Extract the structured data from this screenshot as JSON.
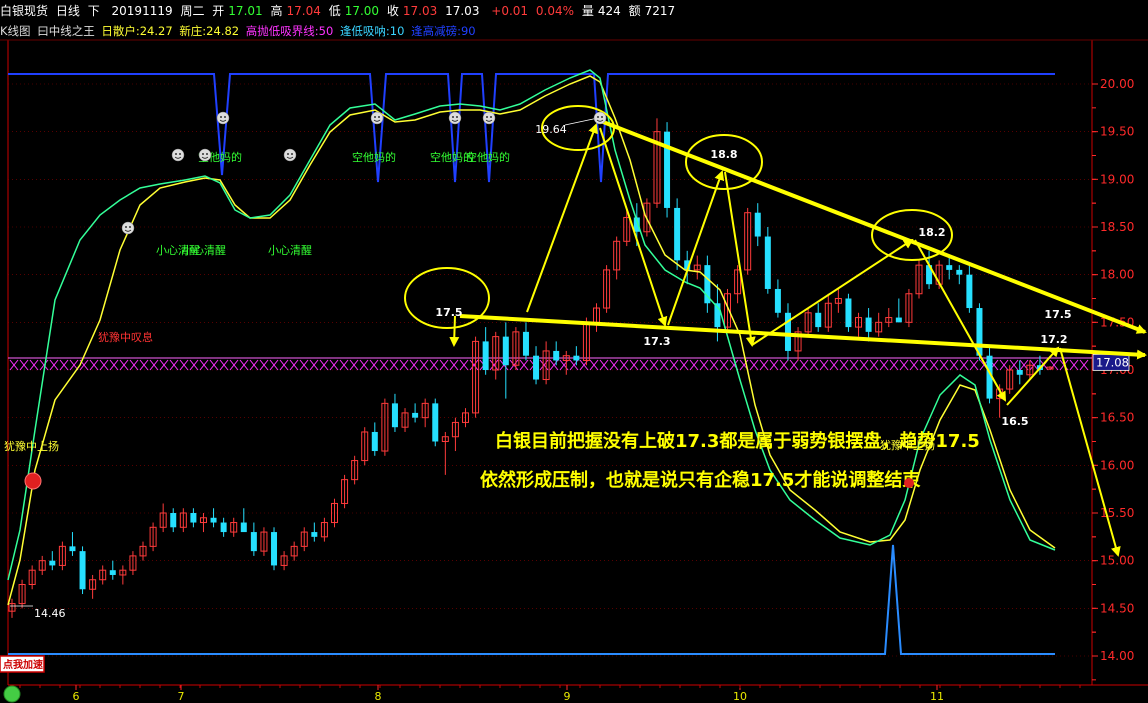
{
  "header": {
    "title": "白银现货",
    "period": "日线",
    "dir": "下",
    "date": "20191119",
    "weekday": "周二",
    "open_label": "开",
    "open": "17.01",
    "high_label": "高",
    "high": "17.04",
    "low_label": "低",
    "low": "17.00",
    "close_label": "收",
    "close": "17.03",
    "last": "17.03",
    "change": "+0.01",
    "pct": "0.04%",
    "vol_label": "量",
    "vol": "424",
    "amt_label": "额",
    "amt": "7217"
  },
  "indicator": {
    "chart_label": "K线图",
    "name": "曰中线之王",
    "sanhu": "日散户:24.27",
    "xinzhuang": "新庄:24.82",
    "line1": "高抛低吸界线:50",
    "line2": "逢低吸呐:10",
    "line3": "逢高减磅:90"
  },
  "colors": {
    "up": "#ff3b3b",
    "down": "#26e0ff",
    "ma_yellow": "#ffff33",
    "ma_green": "#33ff99",
    "indicator_blue": "#2040ff",
    "annotation": "#ffff00",
    "grid_red": "#8b0000",
    "axis_red": "#ff2a2a"
  },
  "price_axis": {
    "ticks": [
      "20.00",
      "19.50",
      "19.00",
      "18.50",
      "18.00",
      "17.50",
      "17.00",
      "16.50",
      "16.00",
      "15.50",
      "15.00",
      "14.50",
      "14.00"
    ],
    "current_price": "17.08"
  },
  "time_axis": {
    "ticks": [
      "6",
      "7",
      "8",
      "9",
      "10",
      "11"
    ]
  },
  "chart_data": {
    "type": "candlestick",
    "ylim": [
      13.8,
      20.3
    ],
    "candles": [
      [
        14.47,
        14.6,
        14.4,
        14.55
      ],
      [
        14.55,
        14.8,
        14.5,
        14.75
      ],
      [
        14.75,
        14.95,
        14.7,
        14.9
      ],
      [
        14.9,
        15.05,
        14.85,
        15.0
      ],
      [
        15.0,
        15.1,
        14.9,
        14.95
      ],
      [
        14.95,
        15.2,
        14.9,
        15.15
      ],
      [
        15.15,
        15.3,
        15.05,
        15.1
      ],
      [
        15.1,
        15.15,
        14.65,
        14.7
      ],
      [
        14.7,
        14.85,
        14.6,
        14.8
      ],
      [
        14.8,
        14.95,
        14.75,
        14.9
      ],
      [
        14.9,
        15.0,
        14.8,
        14.85
      ],
      [
        14.85,
        14.95,
        14.75,
        14.9
      ],
      [
        14.9,
        15.1,
        14.85,
        15.05
      ],
      [
        15.05,
        15.2,
        15.0,
        15.15
      ],
      [
        15.15,
        15.4,
        15.1,
        15.35
      ],
      [
        15.35,
        15.6,
        15.3,
        15.5
      ],
      [
        15.5,
        15.55,
        15.3,
        15.35
      ],
      [
        15.35,
        15.55,
        15.3,
        15.5
      ],
      [
        15.5,
        15.55,
        15.35,
        15.4
      ],
      [
        15.4,
        15.5,
        15.3,
        15.45
      ],
      [
        15.45,
        15.55,
        15.35,
        15.4
      ],
      [
        15.4,
        15.45,
        15.25,
        15.3
      ],
      [
        15.3,
        15.45,
        15.25,
        15.4
      ],
      [
        15.4,
        15.55,
        15.35,
        15.3
      ],
      [
        15.3,
        15.4,
        15.05,
        15.1
      ],
      [
        15.1,
        15.35,
        15.05,
        15.3
      ],
      [
        15.3,
        15.35,
        14.9,
        14.95
      ],
      [
        14.95,
        15.1,
        14.9,
        15.05
      ],
      [
        15.05,
        15.2,
        15.0,
        15.15
      ],
      [
        15.15,
        15.35,
        15.1,
        15.3
      ],
      [
        15.3,
        15.4,
        15.2,
        15.25
      ],
      [
        15.25,
        15.45,
        15.2,
        15.4
      ],
      [
        15.4,
        15.65,
        15.35,
        15.6
      ],
      [
        15.6,
        15.9,
        15.55,
        15.85
      ],
      [
        15.85,
        16.1,
        15.8,
        16.05
      ],
      [
        16.05,
        16.4,
        16.0,
        16.35
      ],
      [
        16.35,
        16.45,
        16.1,
        16.15
      ],
      [
        16.15,
        16.7,
        16.1,
        16.65
      ],
      [
        16.65,
        16.75,
        16.35,
        16.4
      ],
      [
        16.4,
        16.6,
        16.35,
        16.55
      ],
      [
        16.55,
        16.65,
        16.45,
        16.5
      ],
      [
        16.5,
        16.7,
        16.4,
        16.65
      ],
      [
        16.65,
        16.7,
        16.2,
        16.25
      ],
      [
        16.25,
        16.35,
        15.9,
        16.3
      ],
      [
        16.3,
        16.5,
        16.15,
        16.45
      ],
      [
        16.45,
        16.6,
        16.4,
        16.55
      ],
      [
        16.55,
        17.35,
        16.5,
        17.3
      ],
      [
        17.3,
        17.45,
        16.95,
        17.0
      ],
      [
        17.0,
        17.4,
        16.9,
        17.35
      ],
      [
        17.35,
        17.5,
        16.7,
        17.05
      ],
      [
        17.05,
        17.45,
        17.0,
        17.4
      ],
      [
        17.4,
        17.5,
        17.1,
        17.15
      ],
      [
        17.15,
        17.25,
        16.85,
        16.9
      ],
      [
        16.9,
        17.3,
        16.85,
        17.2
      ],
      [
        17.2,
        17.3,
        17.05,
        17.1
      ],
      [
        17.1,
        17.2,
        16.95,
        17.15
      ],
      [
        17.15,
        17.25,
        17.05,
        17.1
      ],
      [
        17.1,
        17.55,
        17.05,
        17.5
      ],
      [
        17.5,
        17.7,
        17.4,
        17.65
      ],
      [
        17.65,
        18.1,
        17.6,
        18.05
      ],
      [
        18.05,
        18.4,
        17.95,
        18.35
      ],
      [
        18.35,
        18.7,
        18.3,
        18.6
      ],
      [
        18.6,
        18.75,
        18.3,
        18.45
      ],
      [
        18.45,
        18.8,
        18.4,
        18.75
      ],
      [
        18.75,
        19.64,
        18.7,
        19.5
      ],
      [
        19.5,
        19.6,
        18.6,
        18.7
      ],
      [
        18.7,
        18.8,
        18.05,
        18.15
      ],
      [
        18.15,
        18.25,
        17.9,
        18.05
      ],
      [
        18.05,
        18.2,
        17.95,
        18.1
      ],
      [
        18.1,
        18.2,
        17.6,
        17.7
      ],
      [
        17.7,
        17.9,
        17.3,
        17.45
      ],
      [
        17.45,
        17.85,
        17.4,
        17.8
      ],
      [
        17.8,
        18.1,
        17.7,
        18.05
      ],
      [
        18.05,
        18.7,
        18.0,
        18.65
      ],
      [
        18.65,
        18.75,
        18.3,
        18.4
      ],
      [
        18.4,
        18.5,
        17.8,
        17.85
      ],
      [
        17.85,
        17.95,
        17.55,
        17.6
      ],
      [
        17.6,
        17.7,
        17.1,
        17.2
      ],
      [
        17.2,
        17.45,
        17.1,
        17.4
      ],
      [
        17.4,
        17.65,
        17.35,
        17.6
      ],
      [
        17.6,
        17.7,
        17.4,
        17.45
      ],
      [
        17.45,
        17.8,
        17.4,
        17.7
      ],
      [
        17.7,
        17.85,
        17.6,
        17.75
      ],
      [
        17.75,
        17.8,
        17.4,
        17.45
      ],
      [
        17.45,
        17.6,
        17.35,
        17.55
      ],
      [
        17.55,
        17.65,
        17.3,
        17.4
      ],
      [
        17.4,
        17.6,
        17.35,
        17.5
      ],
      [
        17.5,
        17.65,
        17.45,
        17.55
      ],
      [
        17.55,
        17.75,
        17.5,
        17.5
      ],
      [
        17.5,
        17.85,
        17.45,
        17.8
      ],
      [
        17.8,
        18.15,
        17.75,
        18.1
      ],
      [
        18.1,
        18.25,
        17.85,
        17.9
      ],
      [
        17.9,
        18.15,
        17.85,
        18.1
      ],
      [
        18.1,
        18.2,
        17.95,
        18.05
      ],
      [
        18.05,
        18.1,
        17.9,
        18.0
      ],
      [
        18.0,
        18.1,
        17.6,
        17.65
      ],
      [
        17.65,
        17.7,
        17.1,
        17.15
      ],
      [
        17.15,
        17.25,
        16.65,
        16.7
      ],
      [
        16.7,
        16.85,
        16.5,
        16.8
      ],
      [
        16.8,
        17.05,
        16.75,
        17.0
      ],
      [
        17.0,
        17.1,
        16.85,
        16.95
      ],
      [
        16.95,
        17.1,
        16.9,
        17.05
      ],
      [
        17.05,
        17.15,
        16.95,
        17.0
      ],
      [
        17.01,
        17.04,
        17.0,
        17.03
      ]
    ],
    "labels": [
      "19.64",
      "14.46"
    ]
  },
  "annotations": {
    "circles": [
      "17.5",
      "18.8",
      "18.2"
    ],
    "points": [
      "17.3",
      "16.5",
      "17.2",
      "17.5"
    ],
    "text_line1": "白银目前把握没有上破17.3都是属于弱势银摆盘，趋势17.5",
    "text_line2": "依然形成压制，也就是说只有企稳17.5才能说调整结束",
    "overlay_labels": [
      "空他妈的",
      "空他妈的",
      "空他妈的",
      "空他妈的",
      "小心清醒",
      "小心清醒",
      "小心清醒",
      "犹豫中叹息",
      "犹豫中上扬",
      "犹豫中上扬"
    ],
    "badge": "点我加速"
  }
}
